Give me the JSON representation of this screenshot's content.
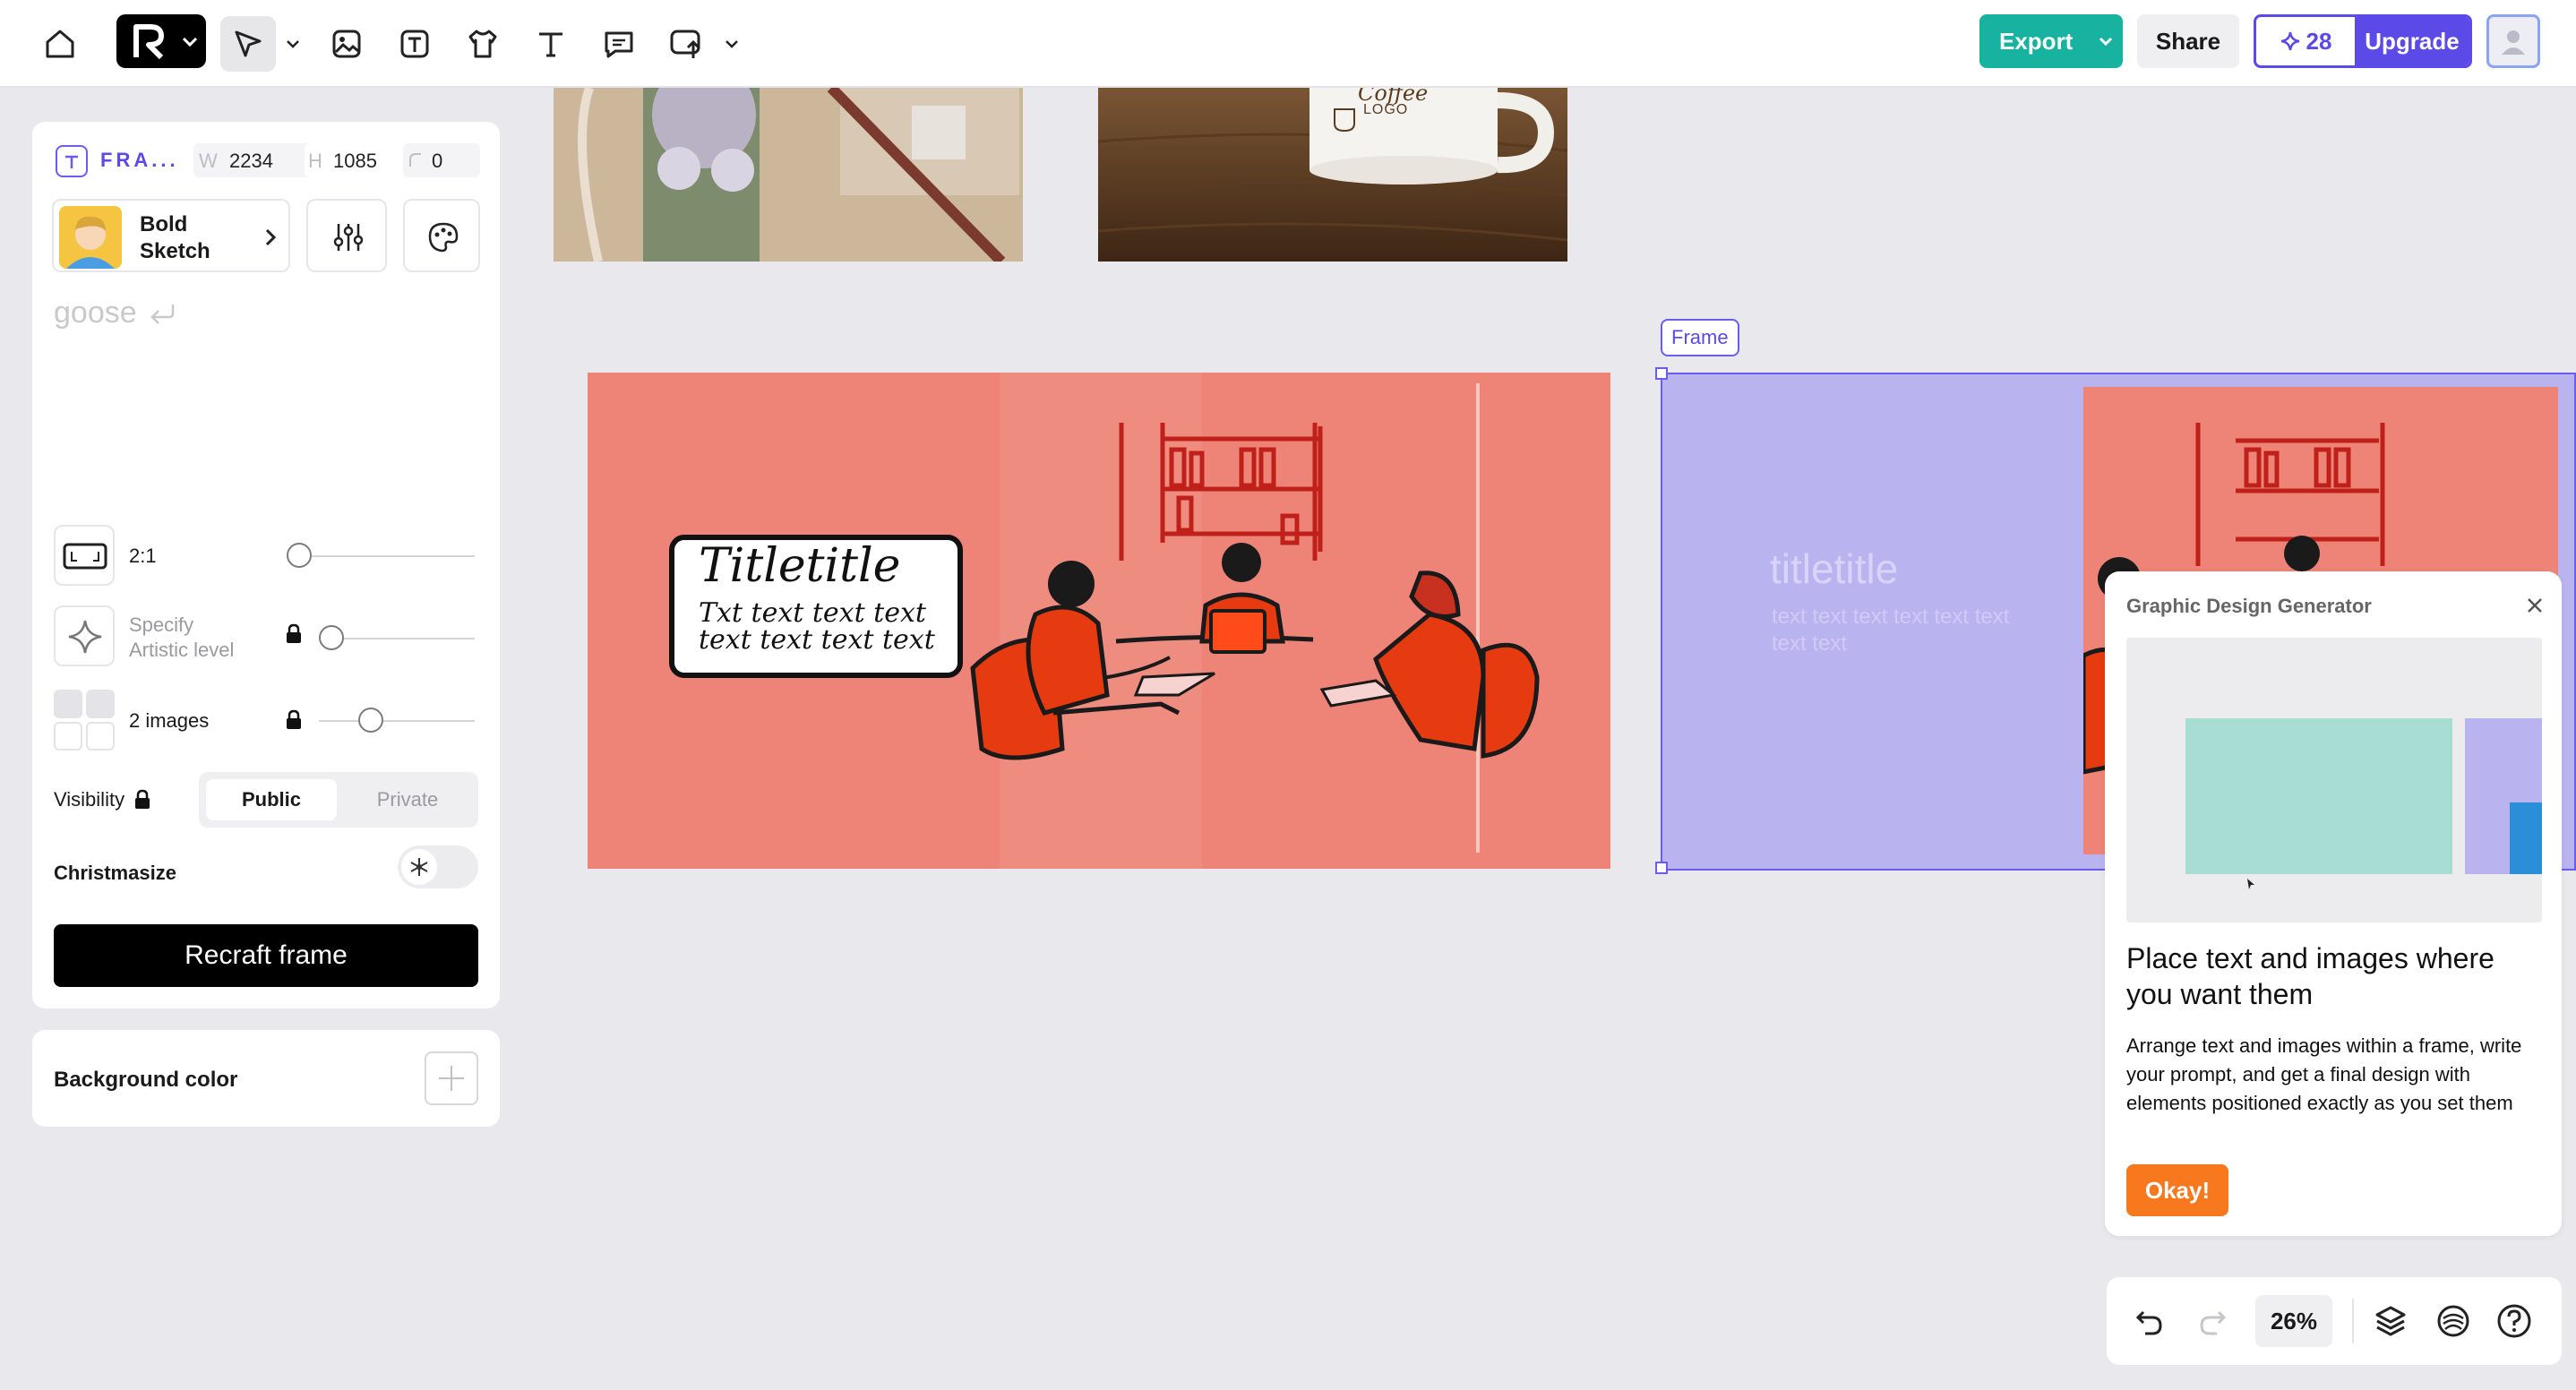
{
  "topbar": {
    "export_label": "Export",
    "share_label": "Share",
    "credits": "28",
    "upgrade_label": "Upgrade",
    "tools": [
      "home-icon",
      "logo-icon",
      "select-tool-icon",
      "image-tool-icon",
      "text-frame-tool-icon",
      "mockup-tool-icon",
      "text-tool-icon",
      "comment-tool-icon",
      "upload-tool-icon"
    ]
  },
  "frame_props": {
    "type_label": "FRA...",
    "w_label": "W",
    "w_value": "2234",
    "h_label": "H",
    "h_value": "1085",
    "radius_value": "0"
  },
  "style": {
    "line1": "Bold",
    "line2": "Sketch"
  },
  "prompt": {
    "text": "goose"
  },
  "settings": {
    "ratio_label": "2:1",
    "artistic_line1": "Specify",
    "artistic_line2": "Artistic level",
    "images_label": "2 images",
    "visibility_label": "Visibility",
    "public_label": "Public",
    "private_label": "Private",
    "christmasize_label": "Christmasize"
  },
  "recraft_label": "Recraft frame",
  "background": {
    "label": "Background color"
  },
  "canvas": {
    "frame_label": "Frame",
    "mug_text1": "Coffee",
    "mug_text2": "LOGO",
    "slide_title": "Titletitle",
    "slide_body": "Txt text text text text text text text",
    "frame_title": "titletitle",
    "frame_body": "text text text text text text text text"
  },
  "popup": {
    "header": "Graphic Design Generator",
    "title": "Place text and images where you want them",
    "body": "Arrange text and images within a frame, write your prompt, and get a final design with elements positioned exactly as you set them",
    "okay_label": "Okay!"
  },
  "bottom_bar": {
    "zoom": "26%"
  },
  "colors": {
    "accent_teal": "#17b3a0",
    "accent_purple": "#5b49e8",
    "canvas_bg": "#e9e9ed",
    "slide_bg": "#ee8478",
    "frame_fill": "#b9b3f0",
    "okay_orange": "#f7781d"
  }
}
